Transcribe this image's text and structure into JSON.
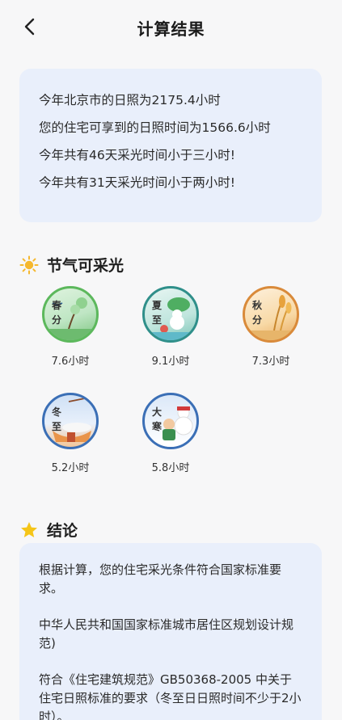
{
  "header": {
    "title": "计算结果"
  },
  "summary": {
    "lines": [
      "今年北京市的日照为2175.4小时",
      "您的住宅可享到的日照时间为1566.6小时",
      "今年共有46天采光时间小于三小时!",
      "今年共有31天采光时间小于两小时!"
    ]
  },
  "solar_terms": {
    "title": "节气可采光",
    "items": [
      {
        "name": "春分",
        "hours": "7.6小时",
        "color": "#5cb85c"
      },
      {
        "name": "夏至",
        "hours": "9.1小时",
        "color": "#2f8f8a"
      },
      {
        "name": "秋分",
        "hours": "7.3小时",
        "color": "#d98a3a"
      },
      {
        "name": "冬至",
        "hours": "5.2小时",
        "color": "#3b6fb6"
      },
      {
        "name": "大寒",
        "hours": "5.8小时",
        "color": "#3b6fb6"
      }
    ]
  },
  "conclusion": {
    "title": "结论",
    "paragraphs": [
      "根据计算，您的住宅采光条件符合国家标准要求。",
      "中华人民共和国国家标准城市居住区规划设计规范)",
      "符合《住宅建筑规范》GB50368-2005 中关于住宅日照标准的要求（冬至日日照时间不少于2小时）。"
    ]
  },
  "icons": {
    "back": "chevron-left-icon",
    "sun": "sun-icon",
    "star": "star-icon"
  },
  "colors": {
    "accent_card": "#e9effb",
    "sun": "#f5b82e",
    "star": "#f5c518"
  }
}
